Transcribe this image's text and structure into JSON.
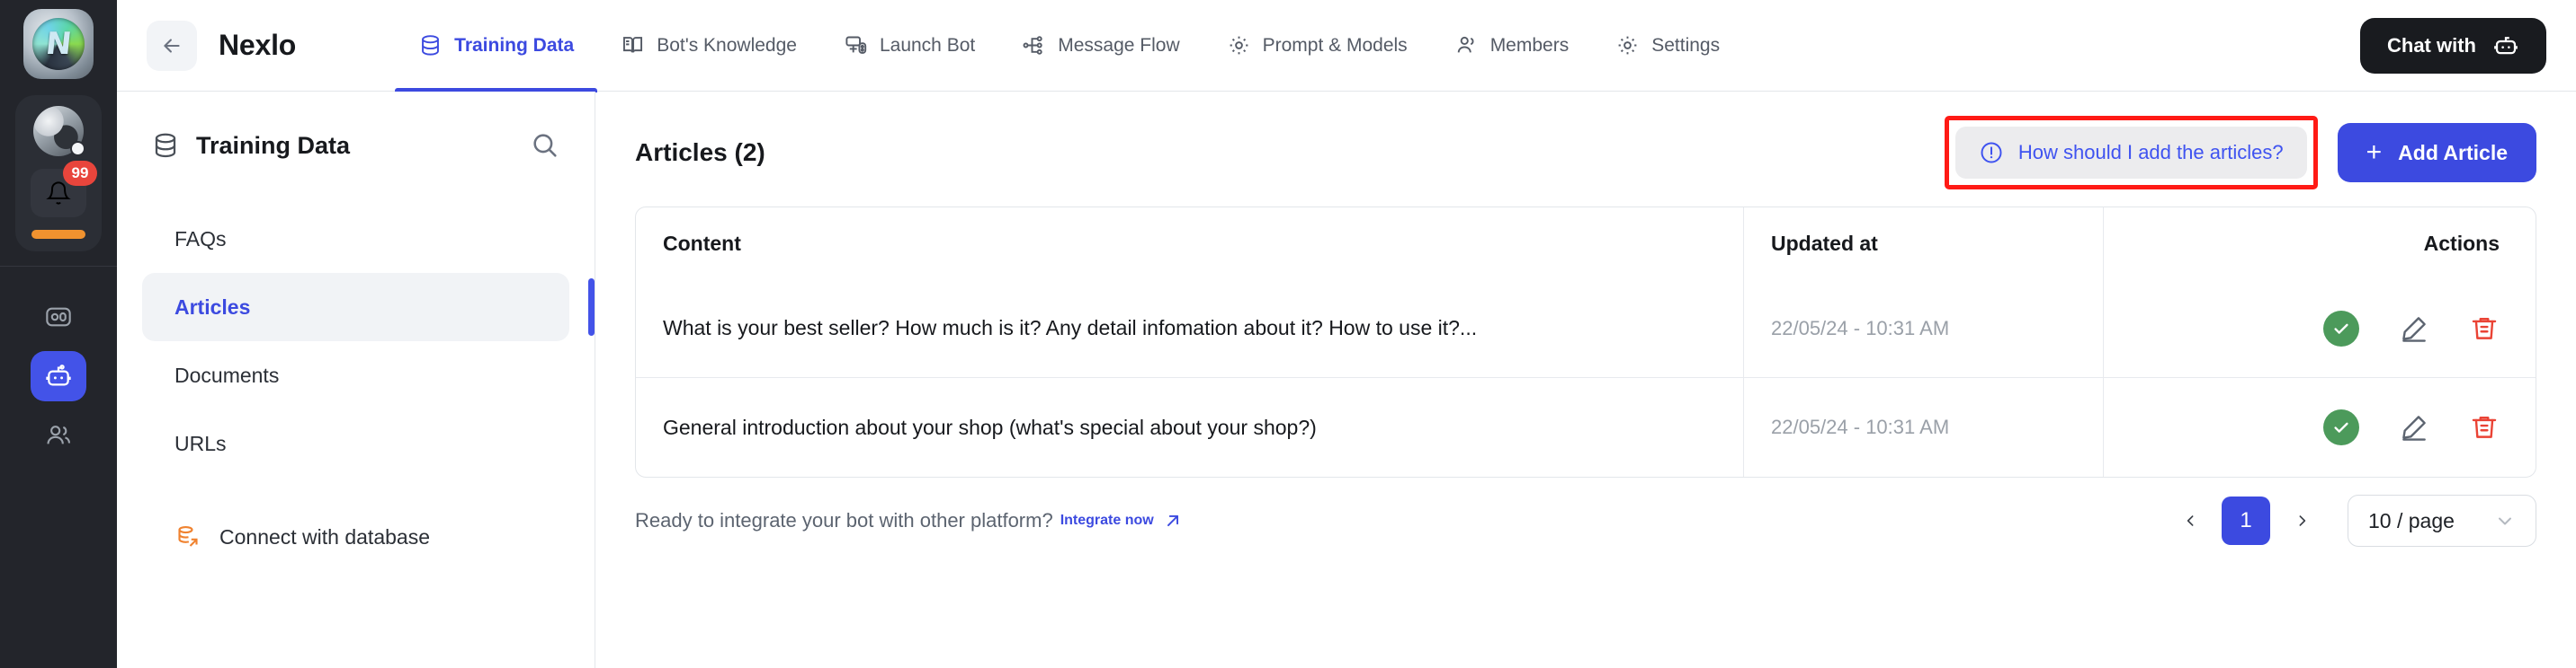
{
  "rail": {
    "logo_letter": "N",
    "notification_badge": "99",
    "items": [
      {
        "name": "dashboard-icon",
        "active": false
      },
      {
        "name": "bot-icon",
        "active": true
      },
      {
        "name": "members-icon",
        "active": false
      }
    ]
  },
  "topbar": {
    "back_label": "back",
    "brand_title": "Nexlo",
    "tabs": [
      {
        "label": "Training Data",
        "icon": "database-icon",
        "active": true
      },
      {
        "label": "Bot's Knowledge",
        "icon": "book-icon",
        "active": false
      },
      {
        "label": "Launch Bot",
        "icon": "launch-icon",
        "active": false
      },
      {
        "label": "Message Flow",
        "icon": "flow-icon",
        "active": false
      },
      {
        "label": "Prompt & Models",
        "icon": "gear-icon",
        "active": false
      },
      {
        "label": "Members",
        "icon": "people-icon",
        "active": false
      },
      {
        "label": "Settings",
        "icon": "gear-icon",
        "active": false
      }
    ],
    "chat_button": "Chat with"
  },
  "sidebar": {
    "title": "Training Data",
    "items": [
      {
        "label": "FAQs",
        "active": false
      },
      {
        "label": "Articles",
        "active": true
      },
      {
        "label": "Documents",
        "active": false
      },
      {
        "label": "URLs",
        "active": false
      }
    ],
    "connect_db": "Connect with database"
  },
  "main": {
    "title": "Articles (2)",
    "hint_label": "How should I add the articles?",
    "add_button": "Add Article",
    "table": {
      "columns": [
        "Content",
        "Updated at",
        "Actions"
      ],
      "rows": [
        {
          "content": "What is your best seller? How much is it? Any detail infomation about it? How to use it?...",
          "updated_at": "22/05/24 - 10:31 AM"
        },
        {
          "content": "General introduction about your shop (what's special about your shop?)",
          "updated_at": "22/05/24 - 10:31 AM"
        }
      ]
    }
  },
  "footer": {
    "text": "Ready to integrate your bot with other platform?",
    "link": "Integrate now",
    "page_number": "1",
    "page_size": "10 / page"
  },
  "colors": {
    "accent": "#3c4ae0",
    "rail_bg": "#23252b",
    "highlight_red": "#ff1a15",
    "success_green": "#4c9a5b",
    "danger_red": "#ea4335",
    "orange": "#f0822f"
  }
}
